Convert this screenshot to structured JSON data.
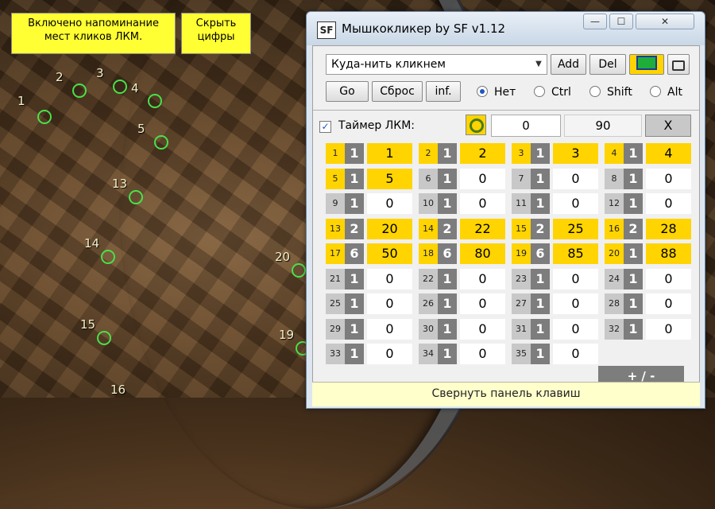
{
  "overlay": {
    "note_reminder": "Включено напоминание мест кликов ЛКМ.",
    "note_hide": "Скрыть цифры"
  },
  "markers": [
    {
      "label": "1"
    },
    {
      "label": "2"
    },
    {
      "label": "3"
    },
    {
      "label": "4"
    },
    {
      "label": "5"
    },
    {
      "label": "13"
    },
    {
      "label": "14"
    },
    {
      "label": "15"
    },
    {
      "label": "16"
    },
    {
      "label": "20"
    },
    {
      "label": "19"
    }
  ],
  "window": {
    "icon_text": "SF",
    "title": "Мышкокликер by SF  v1.12",
    "minimize": "—",
    "maximize": "☐",
    "close": "✕"
  },
  "toolbar": {
    "combo_value": "Куда-нить кликнем",
    "add": "Add",
    "del": "Del",
    "go": "Go",
    "reset": "Сброс",
    "info": "inf.",
    "modifiers": [
      "Нет",
      "Ctrl",
      "Shift",
      "Alt"
    ],
    "selected_modifier": "Нет"
  },
  "timer": {
    "label": "Таймер ЛКМ:",
    "checked": true,
    "value1": "0",
    "value2": "90",
    "clear": "X"
  },
  "grid": [
    {
      "n": "1",
      "c": "1",
      "v": "1",
      "hl": true
    },
    {
      "n": "2",
      "c": "1",
      "v": "2",
      "hl": true
    },
    {
      "n": "3",
      "c": "1",
      "v": "3",
      "hl": true
    },
    {
      "n": "4",
      "c": "1",
      "v": "4",
      "hl": true
    },
    {
      "n": "5",
      "c": "1",
      "v": "5",
      "hl": true
    },
    {
      "n": "6",
      "c": "1",
      "v": "0",
      "hl": false
    },
    {
      "n": "7",
      "c": "1",
      "v": "0",
      "hl": false
    },
    {
      "n": "8",
      "c": "1",
      "v": "0",
      "hl": false
    },
    {
      "n": "9",
      "c": "1",
      "v": "0",
      "hl": false
    },
    {
      "n": "10",
      "c": "1",
      "v": "0",
      "hl": false
    },
    {
      "n": "11",
      "c": "1",
      "v": "0",
      "hl": false
    },
    {
      "n": "12",
      "c": "1",
      "v": "0",
      "hl": false
    },
    {
      "n": "13",
      "c": "2",
      "v": "20",
      "hl": true
    },
    {
      "n": "14",
      "c": "2",
      "v": "22",
      "hl": true
    },
    {
      "n": "15",
      "c": "2",
      "v": "25",
      "hl": true
    },
    {
      "n": "16",
      "c": "2",
      "v": "28",
      "hl": true
    },
    {
      "n": "17",
      "c": "6",
      "v": "50",
      "hl": true
    },
    {
      "n": "18",
      "c": "6",
      "v": "80",
      "hl": true
    },
    {
      "n": "19",
      "c": "6",
      "v": "85",
      "hl": true
    },
    {
      "n": "20",
      "c": "1",
      "v": "88",
      "hl": true
    },
    {
      "n": "21",
      "c": "1",
      "v": "0",
      "hl": false
    },
    {
      "n": "22",
      "c": "1",
      "v": "0",
      "hl": false
    },
    {
      "n": "23",
      "c": "1",
      "v": "0",
      "hl": false
    },
    {
      "n": "24",
      "c": "1",
      "v": "0",
      "hl": false
    },
    {
      "n": "25",
      "c": "1",
      "v": "0",
      "hl": false
    },
    {
      "n": "26",
      "c": "1",
      "v": "0",
      "hl": false
    },
    {
      "n": "27",
      "c": "1",
      "v": "0",
      "hl": false
    },
    {
      "n": "28",
      "c": "1",
      "v": "0",
      "hl": false
    },
    {
      "n": "29",
      "c": "1",
      "v": "0",
      "hl": false
    },
    {
      "n": "30",
      "c": "1",
      "v": "0",
      "hl": false
    },
    {
      "n": "31",
      "c": "1",
      "v": "0",
      "hl": false
    },
    {
      "n": "32",
      "c": "1",
      "v": "0",
      "hl": false
    },
    {
      "n": "33",
      "c": "1",
      "v": "0",
      "hl": false
    },
    {
      "n": "34",
      "c": "1",
      "v": "0",
      "hl": false
    },
    {
      "n": "35",
      "c": "1",
      "v": "0",
      "hl": false
    }
  ],
  "plus_minus": "+ / -",
  "footer": "Свернуть панель клавиш",
  "colors": {
    "highlight": "#ffd400",
    "inactive": "#c8c8c8",
    "value_bg": "#ffffff",
    "marker": "#49e049"
  }
}
